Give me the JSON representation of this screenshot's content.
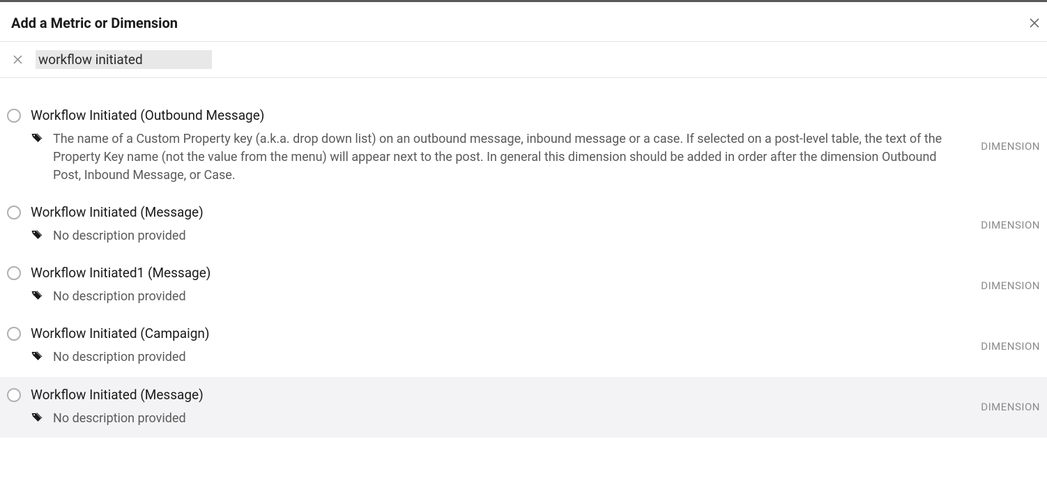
{
  "header": {
    "title": "Add a Metric or Dimension"
  },
  "search": {
    "value": "workflow initiated"
  },
  "type_label": "DIMENSION",
  "results": [
    {
      "title": "Workflow Initiated (Outbound Message)",
      "description": "The name of a Custom Property key (a.k.a. drop down list) on an outbound message, inbound message or a case. If selected on a post-level table, the text of the Property Key name (not the value from the menu) will appear next to the post. In general this dimension should be added in order after the dimension Outbound Post, Inbound Message, or Case.",
      "highlighted": false
    },
    {
      "title": "Workflow Initiated (Message)",
      "description": "No description provided",
      "highlighted": false
    },
    {
      "title": "Workflow Initiated1 (Message)",
      "description": "No description provided",
      "highlighted": false
    },
    {
      "title": "Workflow Initiated (Campaign)",
      "description": "No description provided",
      "highlighted": false
    },
    {
      "title": "Workflow Initiated (Message)",
      "description": "No description provided",
      "highlighted": true
    }
  ]
}
